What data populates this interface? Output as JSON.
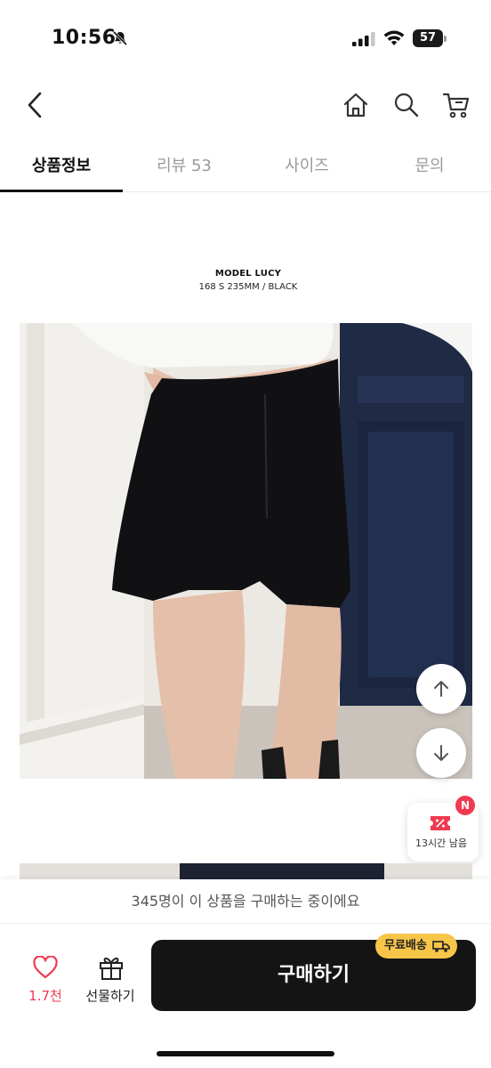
{
  "status_bar": {
    "time": "10:56",
    "battery_level": "57",
    "icons": [
      "bell-off-icon",
      "signal-icon",
      "wifi-icon",
      "battery-icon"
    ]
  },
  "header": {
    "icons": [
      "back-chevron-icon",
      "home-icon",
      "search-icon",
      "cart-icon"
    ]
  },
  "tabs": [
    {
      "label": "상품정보",
      "active": true
    },
    {
      "label": "리뷰 53",
      "active": false
    },
    {
      "label": "사이즈",
      "active": false
    },
    {
      "label": "문의",
      "active": false
    }
  ],
  "model": {
    "title": "MODEL LUCY",
    "info": "168 S 235MM / BLACK"
  },
  "floating": {
    "scroll_up_icon": "arrow-up-icon",
    "scroll_down_icon": "arrow-down-icon",
    "coupon_badge": "N",
    "coupon_time": "13시간 남음"
  },
  "bottom": {
    "buying_notice": "345명이 이 상품을 구매하는 중이에요",
    "like_count": "1.7천",
    "gift_label": "선물하기",
    "buy_label": "구매하기",
    "free_shipping": "무료배송"
  },
  "colors": {
    "accent_red": "#ef3b51",
    "buy_button": "#141414",
    "free_shipping_badge": "#f7c548"
  }
}
